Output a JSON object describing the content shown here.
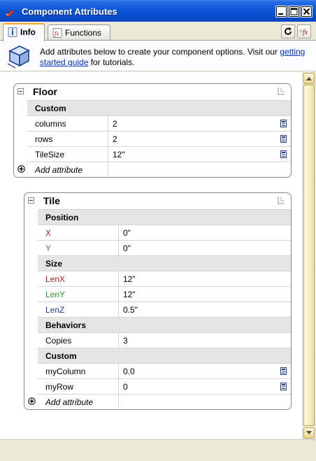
{
  "window": {
    "title": "Component Attributes",
    "icon": "pencil-icon",
    "controls": [
      "minimize-icon",
      "maximize-icon",
      "close-icon"
    ]
  },
  "tabs": [
    {
      "label": "Info",
      "icon": "info-icon",
      "active": true
    },
    {
      "label": "Functions",
      "icon": "function-icon",
      "active": false
    }
  ],
  "toolbar": {
    "refresh_icon": "refresh-icon",
    "fx_icon": "fx-icon"
  },
  "banner": {
    "icon": "component-cube-icon",
    "text_before": "Add attributes below to create your component options. Visit our ",
    "link": "getting started guide",
    "text_after": " for tutorials."
  },
  "colors": {
    "title_bar": "#0b55d6",
    "group_header_bg": "#e5e5e5",
    "x_label": "#b3261e",
    "y_label": "#2a9a2a",
    "z_label": "#1b3f99"
  },
  "components": [
    {
      "name": "Floor",
      "groups": [
        {
          "label": "Custom",
          "rows": [
            {
              "key": "columns",
              "value": "2",
              "calc": true
            },
            {
              "key": "rows",
              "value": "2",
              "calc": true
            },
            {
              "key": "TileSize",
              "value": "12\"",
              "calc": true
            }
          ]
        }
      ],
      "add_label": "Add attribute"
    },
    {
      "name": "Tile",
      "groups": [
        {
          "label": "Position",
          "rows": [
            {
              "key": "X",
              "value": "0\"",
              "color": "red"
            },
            {
              "key": "Y",
              "value": "0\"",
              "color": "green"
            }
          ]
        },
        {
          "label": "Size",
          "rows": [
            {
              "key": "LenX",
              "value": "12\"",
              "color": "red"
            },
            {
              "key": "LenY",
              "value": "12\"",
              "color": "green"
            },
            {
              "key": "LenZ",
              "value": "0.5\"",
              "color": "blue"
            }
          ]
        },
        {
          "label": "Behaviors",
          "rows": [
            {
              "key": "Copies",
              "value": "3"
            }
          ]
        },
        {
          "label": "Custom",
          "rows": [
            {
              "key": "myColumn",
              "value": "0.0",
              "calc": true
            },
            {
              "key": "myRow",
              "value": "0",
              "calc": true
            }
          ]
        }
      ],
      "add_label": "Add attribute"
    }
  ]
}
